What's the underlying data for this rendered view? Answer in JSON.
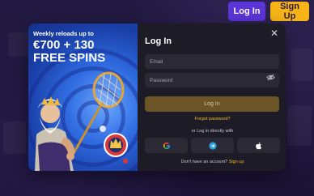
{
  "header": {
    "login_label": "Log In",
    "signup_label": "Sign Up"
  },
  "promo": {
    "line1": "Weekly reloads up to",
    "line2": "€700 + 130",
    "line3": "FREE SPINS"
  },
  "login_modal": {
    "title": "Log In",
    "email_placeholder": "Email",
    "password_placeholder": "Password",
    "login_button": "Log In",
    "forgot_password": "Forgot password?",
    "divider_text": "or Log in directly with",
    "social": [
      {
        "icon": "google-icon"
      },
      {
        "icon": "telegram-icon"
      },
      {
        "icon": "apple-icon"
      }
    ],
    "footer_text": "Don't have an account?",
    "signup_link": "Sign up"
  },
  "colors": {
    "accent": "#f4b827",
    "primary": "#5a35d8",
    "modal_bg": "#1d1b26",
    "login_button": "#6b5426"
  }
}
